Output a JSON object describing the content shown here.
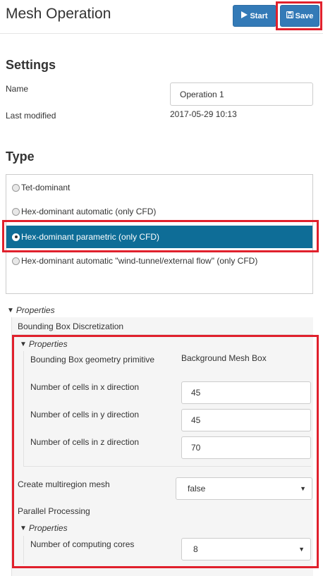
{
  "header": {
    "title": "Mesh Operation",
    "start_label": "Start",
    "save_label": "Save"
  },
  "settings": {
    "heading": "Settings",
    "name_label": "Name",
    "name_value": "Operation 1",
    "modified_label": "Last modified",
    "modified_value": "2017-05-29 10:13"
  },
  "type": {
    "heading": "Type",
    "options": [
      {
        "label": "Tet-dominant",
        "selected": false
      },
      {
        "label": "Hex-dominant automatic (only CFD)",
        "selected": false
      },
      {
        "label": "Hex-dominant parametric (only CFD)",
        "selected": true
      },
      {
        "label": "Hex-dominant automatic \"wind-tunnel/external flow\" (only CFD)",
        "selected": false
      }
    ]
  },
  "properties": {
    "toggle_label": "Properties",
    "bbox_heading": "Bounding Box Discretization",
    "inner_toggle_label": "Properties",
    "primitive_label": "Bounding Box geometry primitive",
    "primitive_value": "Background Mesh Box",
    "cells_x_label": "Number of cells in x direction",
    "cells_x_value": "45",
    "cells_y_label": "Number of cells in y direction",
    "cells_y_value": "45",
    "cells_z_label": "Number of cells in z direction",
    "cells_z_value": "70",
    "multiregion_label": "Create multiregion mesh",
    "multiregion_value": "false",
    "parallel_heading": "Parallel Processing",
    "parallel_toggle_label": "Properties",
    "cores_label": "Number of computing cores",
    "cores_value": "8"
  },
  "icons": {
    "start": "play-icon",
    "save": "floppy-disk-icon",
    "expand": "caret-down-icon",
    "select": "dropdown-arrow-icon"
  },
  "colors": {
    "primary_button": "#337ab7",
    "selected_option": "#0e6d97",
    "highlight": "#e0202c",
    "panel_bg": "#f5f5f5"
  }
}
